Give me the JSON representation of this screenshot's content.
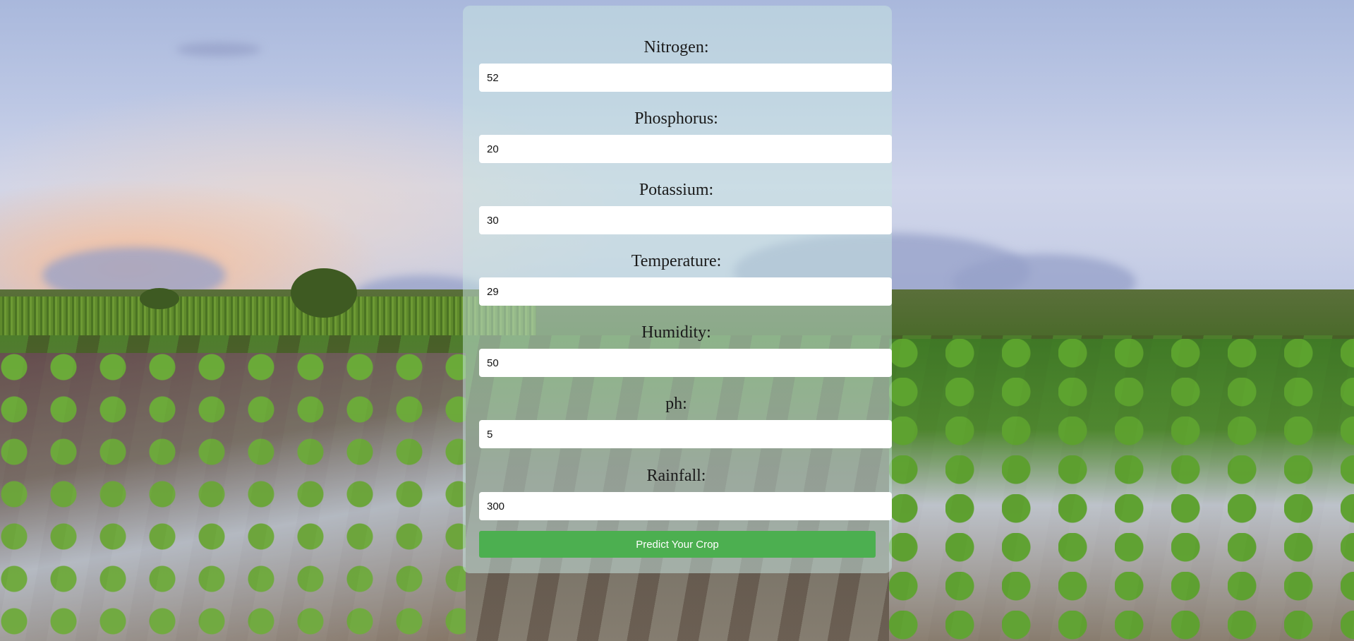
{
  "form": {
    "fields": [
      {
        "label": "Nitrogen:",
        "value": "52"
      },
      {
        "label": "Phosphorus:",
        "value": "20"
      },
      {
        "label": "Potassium:",
        "value": "30"
      },
      {
        "label": "Temperature:",
        "value": "29"
      },
      {
        "label": "Humidity:",
        "value": "50"
      },
      {
        "label": "ph:",
        "value": "5"
      },
      {
        "label": "Rainfall:",
        "value": "300"
      }
    ],
    "submit_label": "Predict Your Crop"
  },
  "colors": {
    "button": "#4caf50",
    "panel": "rgba(200,228,225,0.52)"
  }
}
